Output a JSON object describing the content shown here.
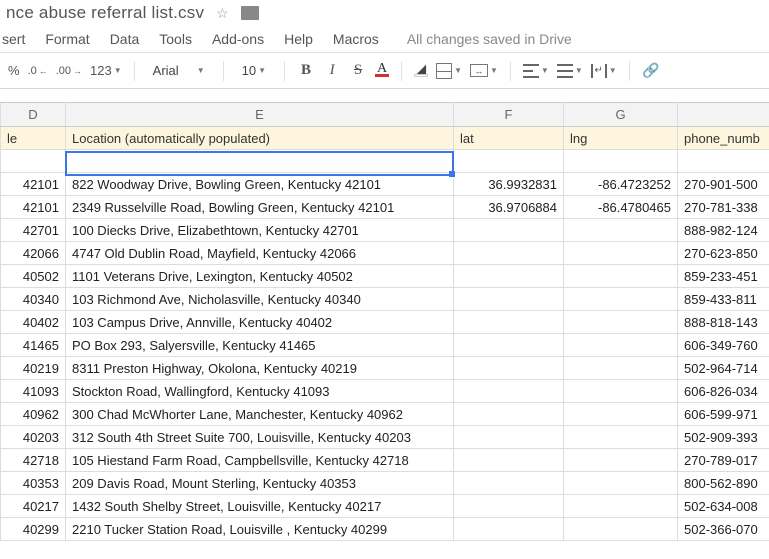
{
  "title": {
    "filename": "nce abuse referral list.csv"
  },
  "menu": {
    "items": [
      "sert",
      "Format",
      "Data",
      "Tools",
      "Add-ons",
      "Help",
      "Macros"
    ],
    "saved": "All changes saved in Drive"
  },
  "toolbar": {
    "percent": "%",
    "dec_dec": ".0",
    "dec_inc": ".00",
    "numfmt": "123",
    "font": "Arial",
    "size": "10"
  },
  "columns": {
    "D": "D",
    "E": "E",
    "F": "F",
    "G": "G"
  },
  "headers": {
    "D": "le",
    "E": "Location (automatically populated)",
    "F": "lat",
    "G": "lng",
    "H": "phone_numb"
  },
  "rows": [
    {
      "d": "",
      "e": "",
      "f": "",
      "g": "",
      "h": ""
    },
    {
      "d": "42101",
      "e": "822 Woodway Drive, Bowling Green, Kentucky 42101",
      "f": "36.9932831",
      "g": "-86.4723252",
      "h": "270-901-500"
    },
    {
      "d": "42101",
      "e": "2349 Russelville Road, Bowling Green, Kentucky 42101",
      "f": "36.9706884",
      "g": "-86.4780465",
      "h": "270-781-338"
    },
    {
      "d": "42701",
      "e": "100 Diecks Drive, Elizabethtown, Kentucky 42701",
      "f": "",
      "g": "",
      "h": "888-982-124"
    },
    {
      "d": "42066",
      "e": "4747 Old Dublin Road, Mayfield, Kentucky 42066",
      "f": "",
      "g": "",
      "h": "270-623-850"
    },
    {
      "d": "40502",
      "e": "1101 Veterans Drive, Lexington, Kentucky 40502",
      "f": "",
      "g": "",
      "h": "859-233-451"
    },
    {
      "d": "40340",
      "e": "103 Richmond Ave, Nicholasville, Kentucky 40340",
      "f": "",
      "g": "",
      "h": "859-433-811"
    },
    {
      "d": "40402",
      "e": "103 Campus Drive, Annville, Kentucky 40402",
      "f": "",
      "g": "",
      "h": "888-818-143"
    },
    {
      "d": "41465",
      "e": "PO Box 293, Salyersville, Kentucky 41465",
      "f": "",
      "g": "",
      "h": "606-349-760"
    },
    {
      "d": "40219",
      "e": "8311 Preston Highway, Okolona, Kentucky 40219",
      "f": "",
      "g": "",
      "h": "502-964-714"
    },
    {
      "d": "41093",
      "e": "Stockton Road, Wallingford, Kentucky 41093",
      "f": "",
      "g": "",
      "h": "606-826-034"
    },
    {
      "d": "40962",
      "e": "300 Chad McWhorter Lane, Manchester, Kentucky 40962",
      "f": "",
      "g": "",
      "h": "606-599-971"
    },
    {
      "d": "40203",
      "e": "312 South 4th Street Suite 700, Louisville, Kentucky 40203",
      "f": "",
      "g": "",
      "h": "502-909-393"
    },
    {
      "d": "42718",
      "e": "105 Hiestand Farm Road, Campbellsville, Kentucky 42718",
      "f": "",
      "g": "",
      "h": "270-789-017"
    },
    {
      "d": "40353",
      "e": "209 Davis Road, Mount Sterling, Kentucky 40353",
      "f": "",
      "g": "",
      "h": "800-562-890"
    },
    {
      "d": "40217",
      "e": "1432 South Shelby Street, Louisville, Kentucky 40217",
      "f": "",
      "g": "",
      "h": "502-634-008"
    },
    {
      "d": "40299",
      "e": "2210 Tucker Station Road, Louisville , Kentucky 40299",
      "f": "",
      "g": "",
      "h": "502-366-070"
    }
  ]
}
